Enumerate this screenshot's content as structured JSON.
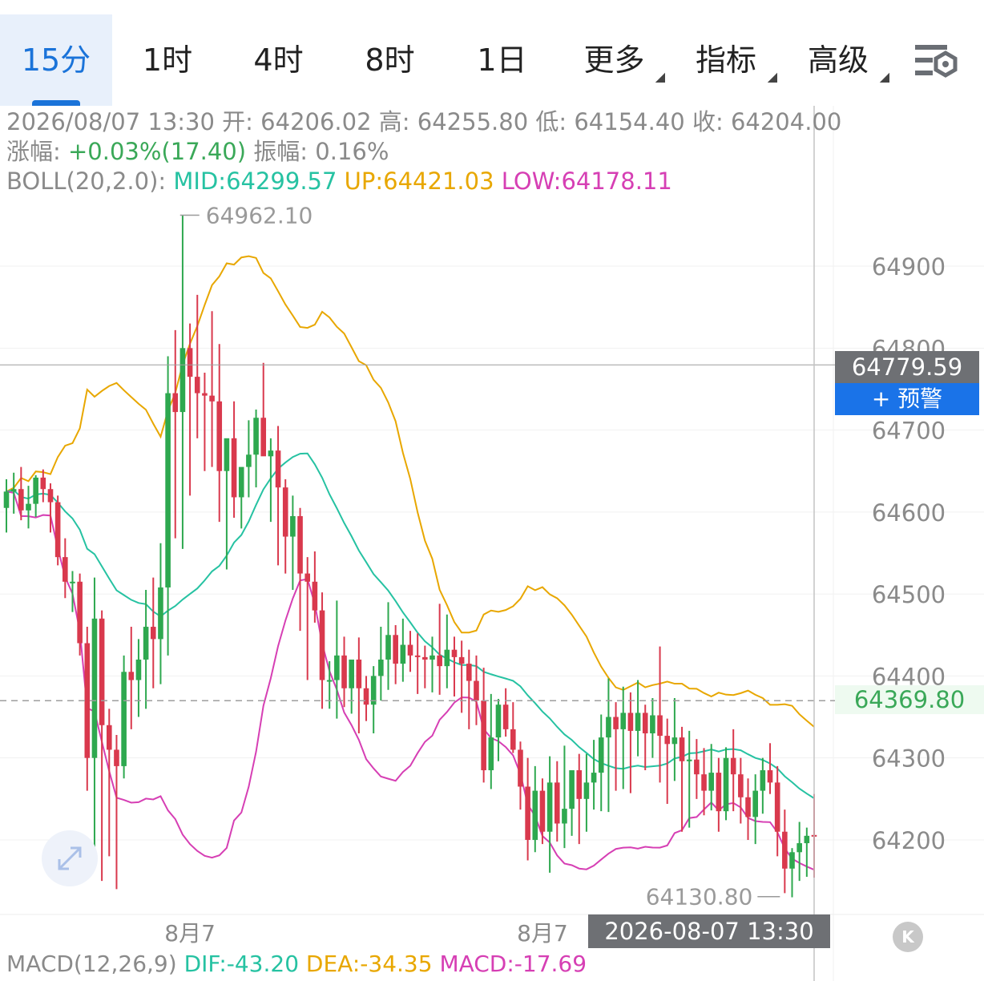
{
  "tabs": {
    "items": [
      {
        "label": "15分",
        "active": true,
        "arrow": false
      },
      {
        "label": "1时",
        "active": false,
        "arrow": false
      },
      {
        "label": "4时",
        "active": false,
        "arrow": false
      },
      {
        "label": "8时",
        "active": false,
        "arrow": false
      },
      {
        "label": "1日",
        "active": false,
        "arrow": false
      },
      {
        "label": "更多",
        "active": false,
        "arrow": true
      },
      {
        "label": "指标",
        "active": false,
        "arrow": true
      },
      {
        "label": "高级",
        "active": false,
        "arrow": true
      }
    ],
    "settings_icon": "chart-settings-icon"
  },
  "info": {
    "datetime": "2026/08/07 13:30",
    "open_label": "开:",
    "open": "64206.02",
    "high_label": "高:",
    "high": "64255.80",
    "low_label": "低:",
    "low": "64154.40",
    "close_label": "收:",
    "close": "64204.00",
    "change_label": "涨幅:",
    "change": "+0.03%(17.40)",
    "amplitude_label": "振幅:",
    "amplitude": "0.16%",
    "boll_label": "BOLL(20,2.0):",
    "boll_mid": "MID:64299.57",
    "boll_up": "UP:64421.03",
    "boll_low": "LOW:64178.11"
  },
  "overlay": {
    "last_price": "64779.59",
    "alert_label": "+ 预警",
    "current_price": "64369.80",
    "crosshair_time": "2026-08-07 13:30"
  },
  "macd": {
    "label": "MACD(12,26,9)",
    "dif": "DIF:-43.20",
    "dea": "DEA:-34.35",
    "macd": "MACD:-17.69"
  },
  "chart_data": {
    "type": "candlestick",
    "y_ticks": [
      64900,
      64800,
      64700,
      64600,
      64500,
      64400,
      64300,
      64200
    ],
    "y_tick_labels": [
      "64900",
      "64800",
      "64700",
      "64600",
      "64500",
      "64400",
      "64300",
      "64200"
    ],
    "ylim": [
      64110,
      64990
    ],
    "x_labels": [
      {
        "label": "8月7",
        "index": 25
      },
      {
        "label": "8月7",
        "index": 73
      }
    ],
    "max_annotation": {
      "label": "64962.10",
      "value": 64962.1,
      "index": 23
    },
    "min_annotation": {
      "label": "64130.80",
      "value": 64130.8,
      "index": 106
    },
    "crosshair_index": 110,
    "last_price_value": 64779.59,
    "current_price_value": 64369.8,
    "colors": {
      "up": "#2ea84f",
      "down": "#d9394d",
      "boll_up": "#e8a700",
      "boll_mid": "#26c2a2",
      "boll_low": "#d63fb4"
    },
    "candles": [
      [
        64605,
        64640,
        64575,
        64625
      ],
      [
        64625,
        64648,
        64598,
        64628
      ],
      [
        64628,
        64655,
        64590,
        64602
      ],
      [
        64602,
        64632,
        64580,
        64610
      ],
      [
        64610,
        64645,
        64594,
        64642
      ],
      [
        64642,
        64652,
        64612,
        64628
      ],
      [
        64628,
        64635,
        64575,
        64612
      ],
      [
        64612,
        64620,
        64535,
        64545
      ],
      [
        64545,
        64568,
        64495,
        64515
      ],
      [
        64515,
        64528,
        64478,
        64515
      ],
      [
        64515,
        64525,
        64425,
        64440
      ],
      [
        64440,
        64460,
        64260,
        64300
      ],
      [
        64300,
        64520,
        64190,
        64470
      ],
      [
        64470,
        64480,
        64150,
        64340
      ],
      [
        64340,
        64360,
        64180,
        64310
      ],
      [
        64310,
        64328,
        64140,
        64290
      ],
      [
        64290,
        64425,
        64275,
        64405
      ],
      [
        64405,
        64460,
        64335,
        64395
      ],
      [
        64395,
        64445,
        64350,
        64420
      ],
      [
        64420,
        64505,
        64360,
        64460
      ],
      [
        64460,
        64520,
        64385,
        64445
      ],
      [
        64445,
        64562,
        64390,
        64508
      ],
      [
        64508,
        64790,
        64425,
        64745
      ],
      [
        64745,
        64822,
        64568,
        64722
      ],
      [
        64722,
        64962,
        64555,
        64800
      ],
      [
        64800,
        64830,
        64620,
        64765
      ],
      [
        64765,
        64865,
        64690,
        64745
      ],
      [
        64745,
        64770,
        64650,
        64742
      ],
      [
        64742,
        64845,
        64655,
        64735
      ],
      [
        64735,
        64805,
        64588,
        64650
      ],
      [
        64650,
        64670,
        64530,
        64690
      ],
      [
        64690,
        64735,
        64593,
        64618
      ],
      [
        64618,
        64650,
        64580,
        64655
      ],
      [
        64655,
        64712,
        64618,
        64670
      ],
      [
        64670,
        64725,
        64630,
        64715
      ],
      [
        64715,
        64782,
        64672,
        64668
      ],
      [
        64668,
        64690,
        64588,
        64675
      ],
      [
        64675,
        64705,
        64535,
        64630
      ],
      [
        64630,
        64640,
        64525,
        64570
      ],
      [
        64570,
        64620,
        64505,
        64595
      ],
      [
        64595,
        64605,
        64455,
        64525
      ],
      [
        64525,
        64545,
        64395,
        64515
      ],
      [
        64515,
        64552,
        64465,
        64480
      ],
      [
        64480,
        64502,
        64360,
        64395
      ],
      [
        64395,
        64418,
        64360,
        64395
      ],
      [
        64395,
        64492,
        64348,
        64425
      ],
      [
        64425,
        64448,
        64362,
        64385
      ],
      [
        64385,
        64412,
        64354,
        64420
      ],
      [
        64420,
        64447,
        64330,
        64385
      ],
      [
        64385,
        64400,
        64345,
        64365
      ],
      [
        64365,
        64412,
        64330,
        64400
      ],
      [
        64400,
        64460,
        64370,
        64420
      ],
      [
        64420,
        64490,
        64383,
        64450
      ],
      [
        64450,
        64462,
        64390,
        64415
      ],
      [
        64415,
        64470,
        64393,
        64438
      ],
      [
        64438,
        64455,
        64405,
        64425
      ],
      [
        64425,
        64452,
        64378,
        64423
      ],
      [
        64423,
        64437,
        64385,
        64420
      ],
      [
        64420,
        64448,
        64380,
        64425
      ],
      [
        64425,
        64488,
        64377,
        64412
      ],
      [
        64412,
        64475,
        64385,
        64432
      ],
      [
        64432,
        64448,
        64375,
        64423
      ],
      [
        64423,
        64443,
        64355,
        64415
      ],
      [
        64415,
        64432,
        64335,
        64394
      ],
      [
        64394,
        64425,
        64340,
        64370
      ],
      [
        64370,
        64410,
        64270,
        64285
      ],
      [
        64285,
        64378,
        64262,
        64325
      ],
      [
        64325,
        64372,
        64296,
        64365
      ],
      [
        64365,
        64385,
        64326,
        64335
      ],
      [
        64335,
        64368,
        64306,
        64310
      ],
      [
        64310,
        64320,
        64237,
        64265
      ],
      [
        64265,
        64300,
        64175,
        64200
      ],
      [
        64200,
        64290,
        64185,
        64260
      ],
      [
        64260,
        64275,
        64195,
        64210
      ],
      [
        64210,
        64302,
        64160,
        64270
      ],
      [
        64270,
        64296,
        64198,
        64220
      ],
      [
        64220,
        64315,
        64190,
        64238
      ],
      [
        64238,
        64277,
        64205,
        64285
      ],
      [
        64285,
        64305,
        64195,
        64250
      ],
      [
        64250,
        64305,
        64210,
        64270
      ],
      [
        64270,
        64322,
        64237,
        64282
      ],
      [
        64282,
        64353,
        64235,
        64325
      ],
      [
        64325,
        64397,
        64234,
        64350
      ],
      [
        64350,
        64368,
        64260,
        64335
      ],
      [
        64335,
        64387,
        64262,
        64355
      ],
      [
        64355,
        64380,
        64257,
        64333
      ],
      [
        64333,
        64395,
        64302,
        64355
      ],
      [
        64355,
        64365,
        64285,
        64330
      ],
      [
        64330,
        64373,
        64300,
        64352
      ],
      [
        64352,
        64436,
        64270,
        64327
      ],
      [
        64327,
        64348,
        64244,
        64317
      ],
      [
        64317,
        64373,
        64272,
        64325
      ],
      [
        64325,
        64338,
        64210,
        64296
      ],
      [
        64296,
        64333,
        64215,
        64298
      ],
      [
        64298,
        64323,
        64250,
        64280
      ],
      [
        64280,
        64312,
        64230,
        64260
      ],
      [
        64260,
        64317,
        64236,
        64282
      ],
      [
        64282,
        64300,
        64210,
        64235
      ],
      [
        64235,
        64313,
        64224,
        64300
      ],
      [
        64300,
        64335,
        64235,
        64280
      ],
      [
        64280,
        64300,
        64220,
        64252
      ],
      [
        64252,
        64275,
        64200,
        64228
      ],
      [
        64228,
        64280,
        64195,
        64260
      ],
      [
        64260,
        64300,
        64232,
        64285
      ],
      [
        64285,
        64318,
        64256,
        64270
      ],
      [
        64270,
        64290,
        64180,
        64210
      ],
      [
        64210,
        64237,
        64135,
        64165
      ],
      [
        64165,
        64190,
        64130,
        64185
      ],
      [
        64185,
        64222,
        64150,
        64196
      ],
      [
        64196,
        64215,
        64155,
        64205
      ],
      [
        64206,
        64256,
        64154,
        64204
      ]
    ]
  }
}
